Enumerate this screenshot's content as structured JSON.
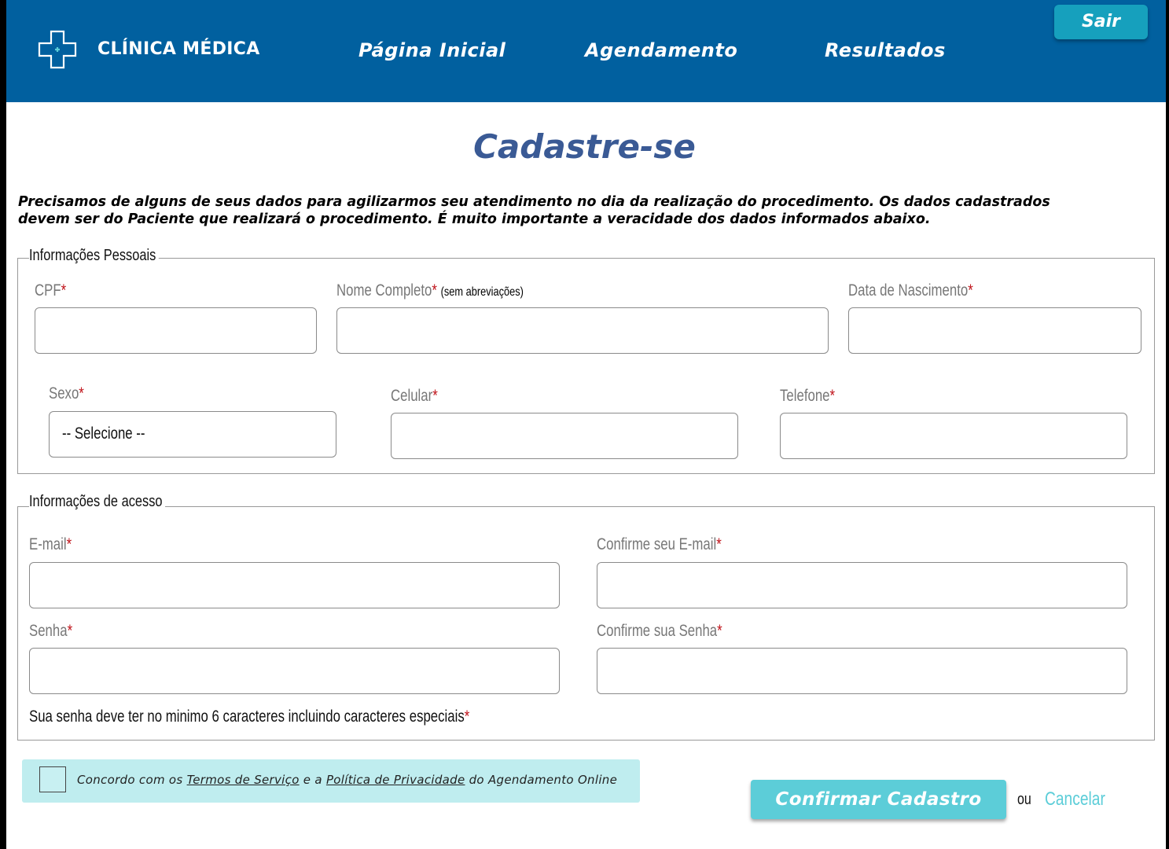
{
  "header": {
    "brand": "CLÍNICA MÉDICA",
    "nav": [
      "Página Inicial",
      "Agendamento",
      "Resultados"
    ],
    "logout_label": "Sair"
  },
  "title": "Cadastre-se",
  "intro_line1": "Precisamos de alguns de seus dados para agilizarmos seu atendimento no dia da realização do procedimento. Os dados cadastrados",
  "intro_line2": "devem ser do Paciente que realizará o procedimento. É muito importante a veracidade dos dados informados abaixo.",
  "personal": {
    "legend": "Informações Pessoais",
    "cpf_label": "CPF",
    "name_label": "Nome Completo",
    "name_hint": "(sem abreviações)",
    "birth_label": "Data de Nascimento",
    "sex_label": "Sexo",
    "sex_value": "-- Selecione --",
    "mobile_label": "Celular",
    "phone_label": "Telefone"
  },
  "access": {
    "legend": "Informações de acesso",
    "email_label": "E-mail",
    "email_confirm_label": "Confirme seu E-mail",
    "password_label": "Senha",
    "password_confirm_label": "Confirme sua Senha",
    "password_note": "Sua senha deve ter no minimo 6 caracteres incluindo caracteres especiais"
  },
  "required_mark": "*",
  "terms": {
    "prefix": "Concordo com os",
    "terms_link": "Termos de Serviço",
    "middle": "e a",
    "privacy_link": "Política de Privacidade",
    "suffix": "do Agendamento Online"
  },
  "actions": {
    "confirm_label": "Confirmar Cadastro",
    "or_label": "ou",
    "cancel_label": "Cancelar"
  },
  "colors": {
    "header_bg": "#01609f",
    "accent": "#5ccdd8",
    "title": "#3a5a95",
    "required": "#c0141b"
  }
}
